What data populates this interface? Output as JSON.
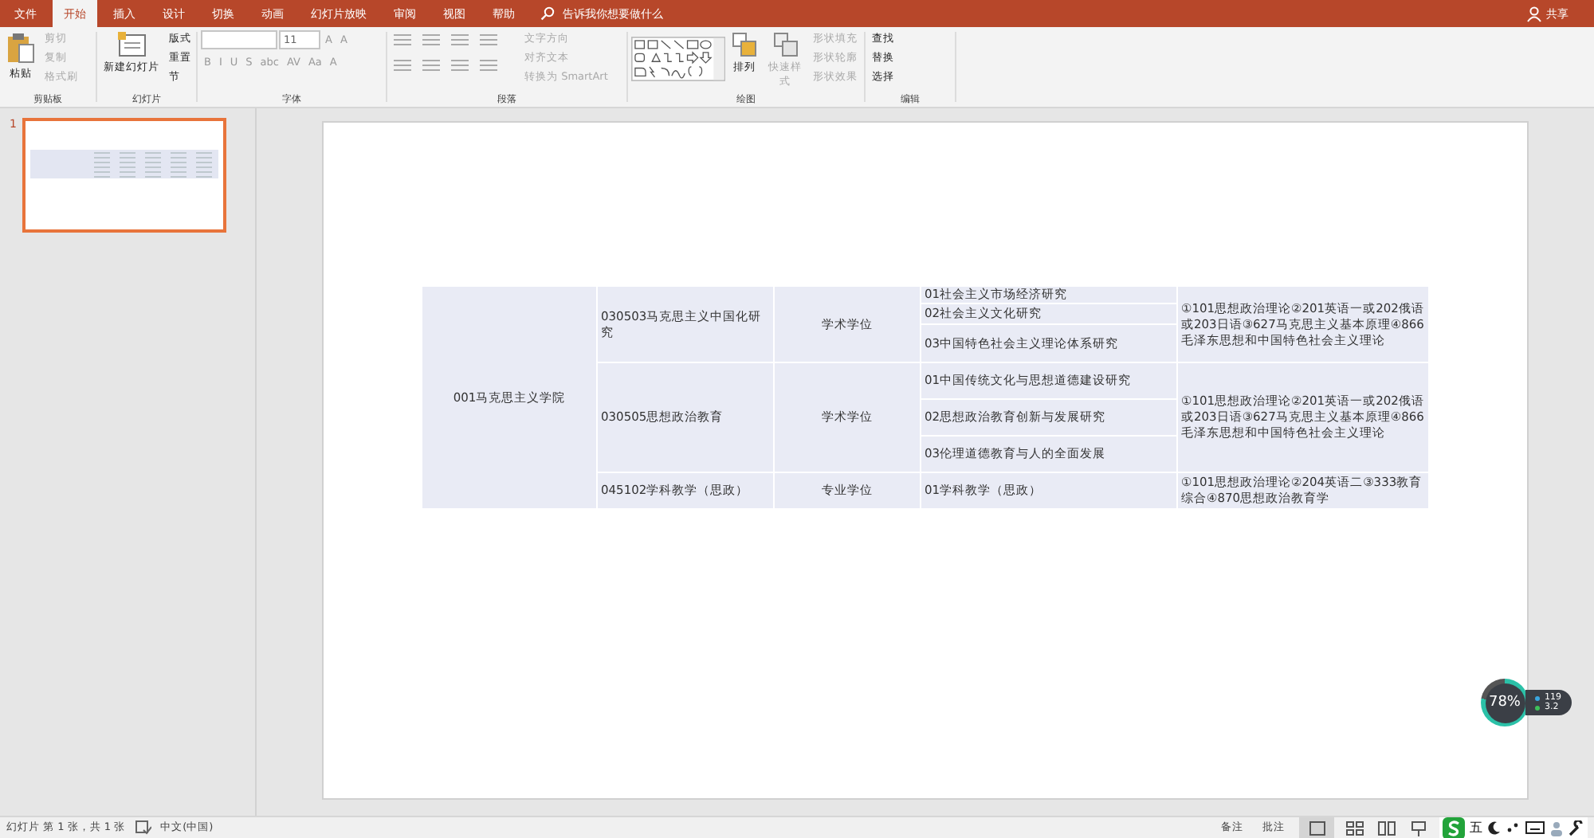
{
  "tabs": [
    {
      "label": "文件",
      "selected": false
    },
    {
      "label": "开始",
      "selected": true
    },
    {
      "label": "插入",
      "selected": false
    },
    {
      "label": "设计",
      "selected": false
    },
    {
      "label": "切换",
      "selected": false
    },
    {
      "label": "动画",
      "selected": false
    },
    {
      "label": "幻灯片放映",
      "selected": false
    },
    {
      "label": "审阅",
      "selected": false
    },
    {
      "label": "视图",
      "selected": false
    },
    {
      "label": "帮助",
      "selected": false
    }
  ],
  "search": {
    "placeholder": "告诉我你想要做什么"
  },
  "share": "共享",
  "ribbon": {
    "groups": [
      {
        "label": "剪贴板",
        "large": [
          {
            "label": "粘贴",
            "disabled": false
          }
        ],
        "items": [
          {
            "label": "剪切",
            "disabled": true
          },
          {
            "label": "复制",
            "disabled": true
          },
          {
            "label": "格式刷",
            "disabled": true
          }
        ]
      },
      {
        "label": "幻灯片",
        "large": [
          {
            "label": "新建幻灯片",
            "disabled": false
          }
        ],
        "items": [
          {
            "label": "版式",
            "disabled": false
          },
          {
            "label": "重置",
            "disabled": false
          },
          {
            "label": "节",
            "disabled": false
          }
        ]
      },
      {
        "label": "字体",
        "size": "11",
        "grow": [
          "A",
          "A"
        ],
        "format": [
          "B",
          "I",
          "U",
          "S",
          "abc",
          "AV",
          "Aa",
          "A"
        ]
      },
      {
        "label": "段落",
        "items": [
          {
            "label": "文字方向",
            "disabled": true
          },
          {
            "label": "对齐文本",
            "disabled": true
          },
          {
            "label": "转换为 SmartArt",
            "disabled": true
          }
        ]
      },
      {
        "label": "绘图",
        "large": [
          {
            "label": "排列",
            "disabled": false
          },
          {
            "label": "快速样式",
            "disabled": true
          }
        ],
        "items": [
          {
            "label": "形状填充",
            "disabled": true
          },
          {
            "label": "形状轮廓",
            "disabled": true
          },
          {
            "label": "形状效果",
            "disabled": true
          }
        ]
      },
      {
        "label": "编辑",
        "items": [
          {
            "label": "查找",
            "disabled": false
          },
          {
            "label": "替换",
            "disabled": false
          },
          {
            "label": "选择",
            "disabled": false
          }
        ]
      }
    ]
  },
  "thumbnails": [
    {
      "number": "1",
      "selected": true
    }
  ],
  "table": {
    "college": "001马克思主义学院",
    "programs": [
      {
        "major": "030503马克思主义中国化研究",
        "degree": "学术学位",
        "directions": [
          "01社会主义市场经济研究",
          "02社会主义文化研究",
          "03中国特色社会主义理论体系研究"
        ],
        "exam": "①101思想政治理论②201英语一或202俄语或203日语③627马克思主义基本原理④866毛泽东思想和中国特色社会主义理论"
      },
      {
        "major": "030505思想政治教育",
        "degree": "学术学位",
        "directions": [
          "01中国传统文化与思想道德建设研究",
          "02思想政治教育创新与发展研究",
          "03伦理道德教育与人的全面发展"
        ],
        "exam": "①101思想政治理论②201英语一或202俄语或203日语③627马克思主义基本原理④866毛泽东思想和中国特色社会主义理论"
      },
      {
        "major": "045102学科教学（思政）",
        "degree": "专业学位",
        "directions": [
          "01学科教学（思政）"
        ],
        "exam": "①101思想政治理论②204英语二③333教育综合④870思想政治教育学"
      }
    ]
  },
  "monitor": {
    "percent": "78%",
    "upload": "119",
    "download": "3.2"
  },
  "status_bar": {
    "slide": "幻灯片 第 1 张，共 1 张",
    "language": "中文(中国)",
    "notes": "备注",
    "comments": "批注",
    "ime": "五"
  }
}
